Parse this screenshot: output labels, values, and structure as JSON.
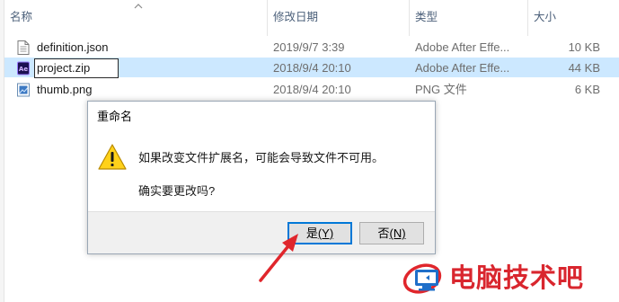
{
  "columns": {
    "name": "名称",
    "date": "修改日期",
    "type": "类型",
    "size": "大小"
  },
  "files": [
    {
      "name": "definition.json",
      "date": "2019/9/7 3:39",
      "type": "Adobe After Effe...",
      "size": "10 KB",
      "icon": "json-file-icon"
    },
    {
      "name": "project.zip",
      "date": "2018/9/4 20:10",
      "type": "Adobe After Effe...",
      "size": "44 KB",
      "icon": "after-effects-file-icon"
    },
    {
      "name": "thumb.png",
      "date": "2018/9/4 20:10",
      "type": "PNG 文件",
      "size": "6 KB",
      "icon": "png-file-icon"
    }
  ],
  "dialog": {
    "title": "重命名",
    "message": "如果改变文件扩展名，可能会导致文件不可用。",
    "question": "确实要更改吗?",
    "yes_label": "是",
    "yes_accel": "(Y)",
    "no_label": "否",
    "no_accel": "(N)",
    "icon": "warning-icon"
  },
  "watermark": {
    "text": "电脑技术吧",
    "color": "#d9262e"
  },
  "colors": {
    "selection": "#cce8ff",
    "header_text": "#4c607a",
    "default_button_border": "#0078d7",
    "arrow": "#e0262c"
  }
}
